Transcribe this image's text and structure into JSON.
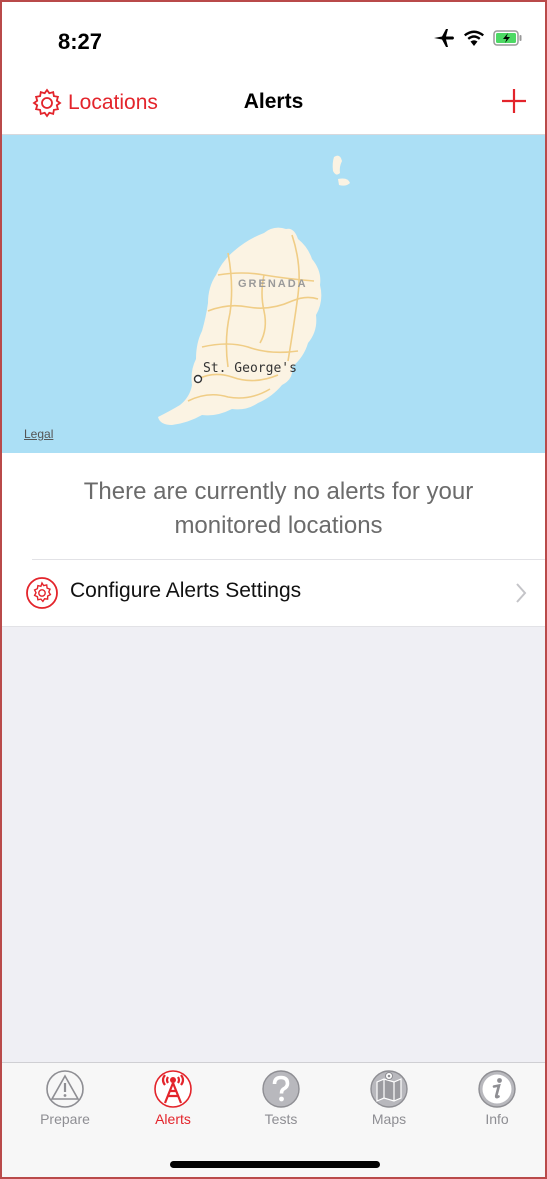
{
  "status_bar": {
    "time": "8:27"
  },
  "nav": {
    "left_label": "Locations",
    "title": "Alerts",
    "add_icon": "plus-icon"
  },
  "map": {
    "country_label": "GRENADA",
    "city_label": "St. George's",
    "legal_label": "Legal"
  },
  "content": {
    "empty_message": "There are currently no alerts for your monitored locations",
    "config_label": "Configure Alerts Settings"
  },
  "tabs": [
    {
      "label": "Prepare",
      "icon": "warning-triangle-icon",
      "active": false
    },
    {
      "label": "Alerts",
      "icon": "alert-tower-icon",
      "active": true
    },
    {
      "label": "Tests",
      "icon": "question-icon",
      "active": false
    },
    {
      "label": "Maps",
      "icon": "map-icon",
      "active": false
    },
    {
      "label": "Info",
      "icon": "info-icon",
      "active": false
    }
  ],
  "colors": {
    "accent": "#e3242b",
    "map_water": "#abdff5",
    "land": "#fbf3e3"
  }
}
